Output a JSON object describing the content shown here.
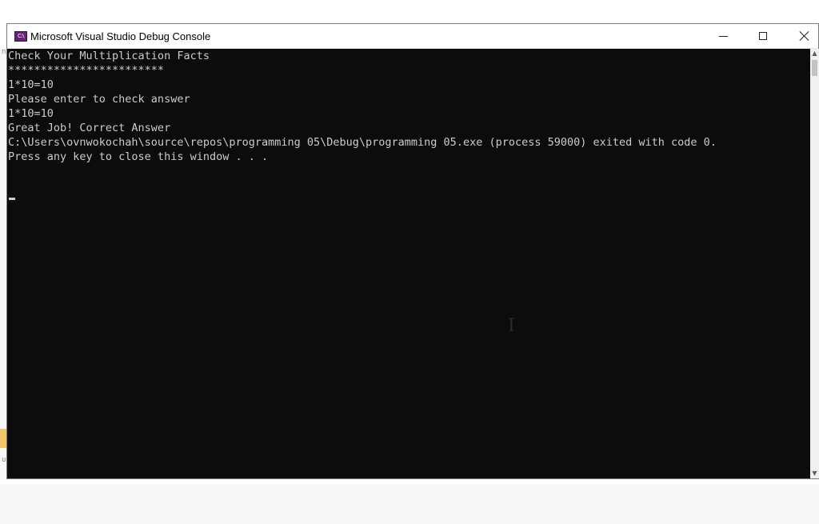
{
  "window": {
    "title": "Microsoft Visual Studio Debug Console",
    "icon_label": "C:\\"
  },
  "console": {
    "lines": [
      "Check Your Multiplication Facts",
      "************************",
      "1*10=10",
      "Please enter to check answer",
      "1*10=10",
      "Great Job! Correct Answer",
      "C:\\Users\\ovnwokochah\\source\\repos\\programming 05\\Debug\\programming 05.exe (process 59000) exited with code 0.",
      "Press any key to close this window . . ."
    ]
  },
  "background_ide": {
    "fragment_top": "n",
    "fragment_bottom": "u"
  },
  "colors": {
    "console_bg": "#0c0c0c",
    "console_text": "#cccccc",
    "icon_accent": "#68217a"
  }
}
